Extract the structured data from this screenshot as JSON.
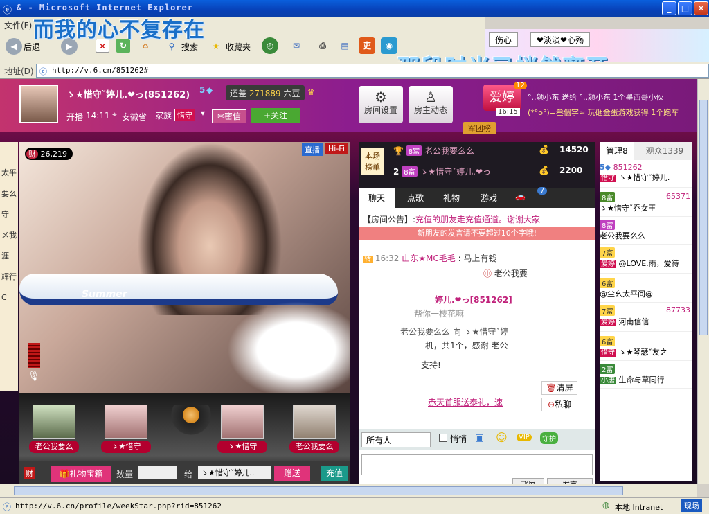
{
  "window": {
    "title": "& - Microsoft Internet Explorer"
  },
  "menu": {
    "items": [
      "文件(F)"
    ]
  },
  "toolbar": {
    "back": "后退",
    "search": "搜索",
    "favorites": "收藏夹"
  },
  "address": {
    "label": "地址(D)",
    "url": "http://v.6.cn/851262#"
  },
  "overlay": {
    "line1": "而我的心不复存在",
    "line2": "那段时光已悄然离开"
  },
  "ie_tabs": [
    {
      "label": "伤心"
    },
    {
      "label": "❤淡淡❤心殇"
    }
  ],
  "host": {
    "name": "ゝ★惜守ˇ婷儿.❤っ(851262)",
    "level": "5",
    "diff_label": "还差",
    "diff_value": "271889",
    "diff_unit": "六豆",
    "start_label": "开播",
    "start_time": "14:11",
    "location": "安徽省",
    "family_label": "家族",
    "family_badge": "惜守",
    "message_button": "密信",
    "follow_button": "+关注",
    "money_label": "财",
    "money_value": "26,219"
  },
  "header_buttons": {
    "room_settings": "房间设置",
    "host_news": "房主动态"
  },
  "banner": {
    "gift_text": "°..颜小东 送给 °..颜小东 1个墨西哥小伙",
    "game_text": "(*°o°)=叁個字≈ 玩砸金蛋游戏获得 1个跑车",
    "love_badge": "爱婷",
    "love_count": "12",
    "time": "16:15",
    "army_tab": "军团榜"
  },
  "video_tags": {
    "live": "直播",
    "hifi": "Hi-Fi"
  },
  "rank": {
    "title": "本场榜单",
    "entries": [
      {
        "rank": "1",
        "level": "8富",
        "name": "老公我要么么",
        "value": "14520"
      },
      {
        "rank": "2",
        "level": "8富",
        "name": "ゝ★惜守ˇ婷儿.❤っ",
        "value": "2200"
      }
    ]
  },
  "chat_tabs": [
    "聊天",
    "点歌",
    "礼物",
    "游戏",
    "7"
  ],
  "chat": {
    "notice_label": "【房间公告】:",
    "notice_text": "充值的朋友走充值通道。谢谢大家",
    "tip": "新朋友的发言请不要超过10个字哦!",
    "lines": [
      {
        "time": "16:32",
        "user": "山东★MC毛毛",
        "text": ": 马上有钱"
      },
      {
        "time": "16:32",
        "user": "",
        "text": "老公我要"
      },
      {
        "time": "",
        "user": "",
        "text": "婷儿.❤っ[851262]"
      },
      {
        "time": "",
        "user": "",
        "text": "帮你一枝花嘛"
      },
      {
        "time": "",
        "user": "",
        "text": "老公我要么么 向 ゝ★惜守ˇ婷"
      },
      {
        "time": "",
        "user": "",
        "text": "机，共1个，感谢 老公"
      },
      {
        "time": "",
        "user": "",
        "text": "支持!"
      }
    ],
    "promo": "赤天首服送泰礼，速",
    "clear_button": "清屏",
    "private_button": "私聊",
    "target": "所有人",
    "whisper": "悄悄",
    "vip_label": "VIP",
    "guard_label": "守护",
    "send_left": "飞屏",
    "send_right": "发言"
  },
  "right_panel": {
    "tab_admin": "管理8",
    "tab_viewers": "观众1339",
    "users": [
      {
        "badge": "5",
        "id": "851262",
        "tag": "惜守",
        "name": "ゝ★惜守ˇ婷儿."
      },
      {
        "badge": "8富",
        "id": "65371",
        "tag": "",
        "name": "ゝ★惜守ˇ乔女王"
      },
      {
        "badge": "8富",
        "id": "",
        "tag": "",
        "name": "老公我要么么"
      },
      {
        "badge": "7富",
        "id": "",
        "tag": "爱婷",
        "name": "@LOVE.雨，爱待"
      },
      {
        "badge": "6富",
        "id": "",
        "tag": "",
        "name": "@尘幺太平间@"
      },
      {
        "badge": "7富",
        "id": "87733",
        "tag": "爱婷",
        "name": "河南信信"
      },
      {
        "badge": "6富",
        "id": "",
        "tag": "惜守",
        "name": "ゝ★琴瑟ˇ友之"
      },
      {
        "badge": "2富",
        "id": "",
        "tag": "小唐",
        "name": "生命与草同行"
      }
    ]
  },
  "seats": [
    {
      "name": "老公我要么"
    },
    {
      "name": "ゝ★惜守"
    },
    {
      "name": ""
    },
    {
      "name": "ゝ★惜守"
    },
    {
      "name": "老公我要么"
    }
  ],
  "gift_bar": {
    "money": "财",
    "gift_box": "礼物宝箱",
    "qty_label": "数量",
    "to_label": "给",
    "to_user": "ゝ★惜守ˇ婷儿..",
    "send": "赠送",
    "recharge": "充值"
  },
  "left_sidebar": [
    "太平",
    "要么",
    "守",
    "メ我",
    "涯",
    "辉行",
    "C"
  ],
  "status": {
    "url": "http://v.6.cn/profile/weekStar.php?rid=851262",
    "zone": "本地 Intranet",
    "corner": "现场"
  },
  "colors": {
    "brand": "#b3002e",
    "accent": "#e0337a",
    "follow": "#4aa832"
  }
}
